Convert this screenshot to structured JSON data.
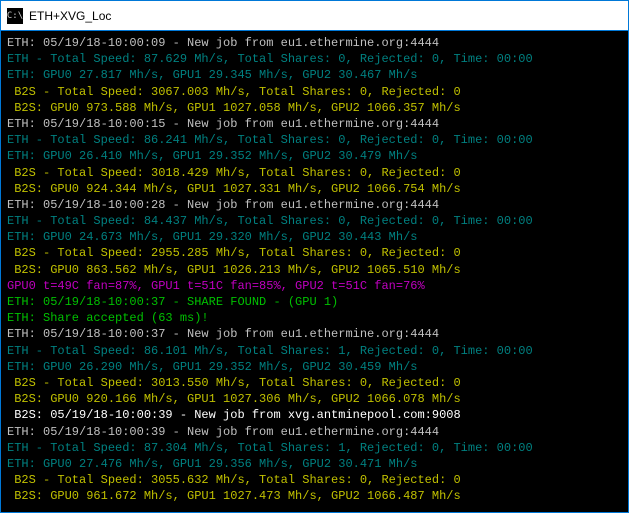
{
  "window": {
    "title": "ETH+XVG_Loc",
    "icon_label": "cmd"
  },
  "lines": [
    {
      "cls": "c-white",
      "text": "ETH: 05/19/18-10:00:09 - New job from eu1.ethermine.org:4444"
    },
    {
      "cls": "c-teal",
      "text": "ETH - Total Speed: 87.629 Mh/s, Total Shares: 0, Rejected: 0, Time: 00:00"
    },
    {
      "cls": "c-teal",
      "text": "ETH: GPU0 27.817 Mh/s, GPU1 29.345 Mh/s, GPU2 30.467 Mh/s"
    },
    {
      "cls": "c-yellow",
      "text": " B2S - Total Speed: 3067.003 Mh/s, Total Shares: 0, Rejected: 0"
    },
    {
      "cls": "c-yellow",
      "text": " B2S: GPU0 973.588 Mh/s, GPU1 1027.058 Mh/s, GPU2 1066.357 Mh/s"
    },
    {
      "cls": "c-white",
      "text": "ETH: 05/19/18-10:00:15 - New job from eu1.ethermine.org:4444"
    },
    {
      "cls": "c-teal",
      "text": "ETH - Total Speed: 86.241 Mh/s, Total Shares: 0, Rejected: 0, Time: 00:00"
    },
    {
      "cls": "c-teal",
      "text": "ETH: GPU0 26.410 Mh/s, GPU1 29.352 Mh/s, GPU2 30.479 Mh/s"
    },
    {
      "cls": "c-yellow",
      "text": " B2S - Total Speed: 3018.429 Mh/s, Total Shares: 0, Rejected: 0"
    },
    {
      "cls": "c-yellow",
      "text": " B2S: GPU0 924.344 Mh/s, GPU1 1027.331 Mh/s, GPU2 1066.754 Mh/s"
    },
    {
      "cls": "c-white",
      "text": "ETH: 05/19/18-10:00:28 - New job from eu1.ethermine.org:4444"
    },
    {
      "cls": "c-teal",
      "text": "ETH - Total Speed: 84.437 Mh/s, Total Shares: 0, Rejected: 0, Time: 00:00"
    },
    {
      "cls": "c-teal",
      "text": "ETH: GPU0 24.673 Mh/s, GPU1 29.320 Mh/s, GPU2 30.443 Mh/s"
    },
    {
      "cls": "c-yellow",
      "text": " B2S - Total Speed: 2955.285 Mh/s, Total Shares: 0, Rejected: 0"
    },
    {
      "cls": "c-yellow",
      "text": " B2S: GPU0 863.562 Mh/s, GPU1 1026.213 Mh/s, GPU2 1065.510 Mh/s"
    },
    {
      "cls": "c-magenta",
      "text": "GPU0 t=49C fan=87%, GPU1 t=51C fan=85%, GPU2 t=51C fan=76%"
    },
    {
      "cls": "c-green",
      "text": "ETH: 05/19/18-10:00:37 - SHARE FOUND - (GPU 1)"
    },
    {
      "cls": "c-green",
      "text": "ETH: Share accepted (63 ms)!"
    },
    {
      "cls": "c-white",
      "text": "ETH: 05/19/18-10:00:37 - New job from eu1.ethermine.org:4444"
    },
    {
      "cls": "c-teal",
      "text": "ETH - Total Speed: 86.101 Mh/s, Total Shares: 1, Rejected: 0, Time: 00:00"
    },
    {
      "cls": "c-teal",
      "text": "ETH: GPU0 26.290 Mh/s, GPU1 29.352 Mh/s, GPU2 30.459 Mh/s"
    },
    {
      "cls": "c-yellow",
      "text": " B2S - Total Speed: 3013.550 Mh/s, Total Shares: 0, Rejected: 0"
    },
    {
      "cls": "c-yellow",
      "text": " B2S: GPU0 920.166 Mh/s, GPU1 1027.306 Mh/s, GPU2 1066.078 Mh/s"
    },
    {
      "cls": "c-bright",
      "text": " B2S: 05/19/18-10:00:39 - New job from xvg.antminepool.com:9008"
    },
    {
      "cls": "c-white",
      "text": "ETH: 05/19/18-10:00:39 - New job from eu1.ethermine.org:4444"
    },
    {
      "cls": "c-teal",
      "text": "ETH - Total Speed: 87.304 Mh/s, Total Shares: 1, Rejected: 0, Time: 00:00"
    },
    {
      "cls": "c-teal",
      "text": "ETH: GPU0 27.476 Mh/s, GPU1 29.356 Mh/s, GPU2 30.471 Mh/s"
    },
    {
      "cls": "c-yellow",
      "text": " B2S - Total Speed: 3055.632 Mh/s, Total Shares: 0, Rejected: 0"
    },
    {
      "cls": "c-yellow",
      "text": " B2S: GPU0 961.672 Mh/s, GPU1 1027.473 Mh/s, GPU2 1066.487 Mh/s"
    }
  ]
}
